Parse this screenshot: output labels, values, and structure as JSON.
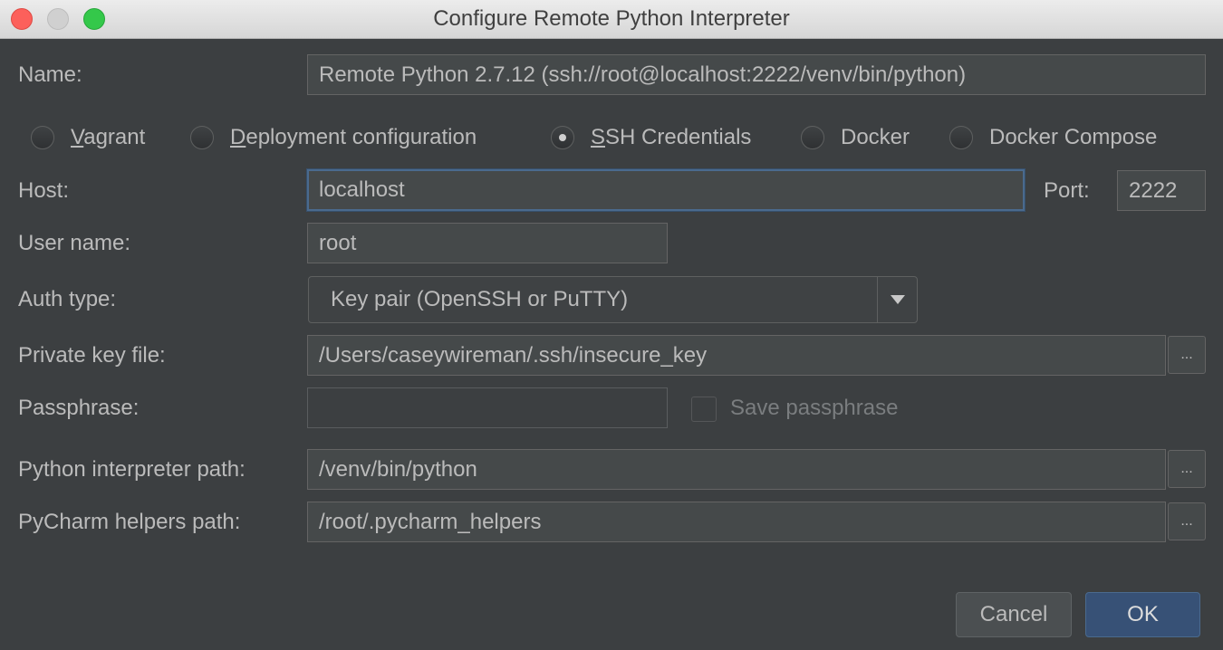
{
  "window": {
    "title": "Configure Remote Python Interpreter"
  },
  "name": {
    "label": "Name:",
    "value": "Remote Python 2.7.12 (ssh://root@localhost:2222/venv/bin/python)"
  },
  "type_options": [
    {
      "first": "V",
      "rest": "agrant",
      "checked": false
    },
    {
      "first": "D",
      "rest": "eployment configuration",
      "checked": false
    },
    {
      "first": "S",
      "rest": "SH Credentials",
      "checked": true
    },
    {
      "first": "",
      "rest": "Docker",
      "checked": false
    },
    {
      "first": "",
      "rest": "Docker Compose",
      "checked": false
    }
  ],
  "host": {
    "label": "Host:",
    "value": "localhost"
  },
  "port": {
    "label": "Port:",
    "value": "2222"
  },
  "username": {
    "label": "User name:",
    "value": "root"
  },
  "auth": {
    "label": "Auth type:",
    "value": "Key pair (OpenSSH or PuTTY)"
  },
  "private_key": {
    "label": "Private key file:",
    "value": "/Users/caseywireman/.ssh/insecure_key",
    "browse": "..."
  },
  "passphrase": {
    "label": "Passphrase:",
    "value": "",
    "save_label": "Save passphrase",
    "save_checked": false
  },
  "interpreter": {
    "label": "Python interpreter path:",
    "value": "/venv/bin/python",
    "browse": "..."
  },
  "helpers": {
    "label": "PyCharm helpers path:",
    "value": "/root/.pycharm_helpers",
    "browse": "..."
  },
  "buttons": {
    "cancel": "Cancel",
    "ok": "OK"
  }
}
